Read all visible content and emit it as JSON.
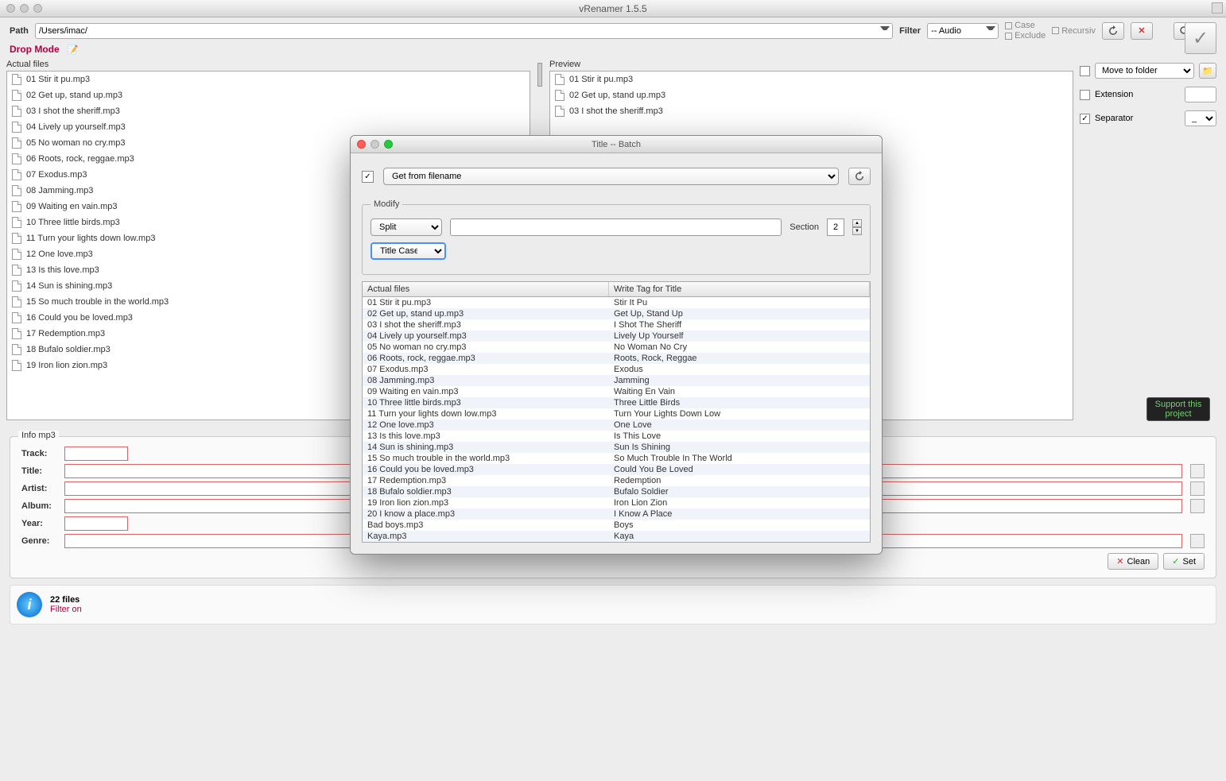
{
  "window": {
    "title": "vRenamer 1.5.5"
  },
  "toolbar": {
    "path_label": "Path",
    "path_value": "/Users/imac/",
    "filter_label": "Filter",
    "filter_value": "-- Audio",
    "case_label": "Case",
    "exclude_label": "Exclude",
    "recursiv_label": "Recursiv"
  },
  "dropmode_label": "Drop Mode",
  "actual_files_label": "Actual files",
  "preview_label": "Preview",
  "actual_files": [
    "01 Stir it pu.mp3",
    "02 Get up, stand up.mp3",
    "03 I shot the sheriff.mp3",
    "04 Lively up yourself.mp3",
    "05 No woman no cry.mp3",
    "06 Roots, rock, reggae.mp3",
    "07 Exodus.mp3",
    "08 Jamming.mp3",
    "09 Waiting en vain.mp3",
    "10 Three little birds.mp3",
    "11 Turn your lights down low.mp3",
    "12 One love.mp3",
    "13 Is this love.mp3",
    "14 Sun is shining.mp3",
    "15 So much trouble in the world.mp3",
    "16 Could you be loved.mp3",
    "17 Redemption.mp3",
    "18 Bufalo soldier.mp3",
    "19 Iron lion zion.mp3"
  ],
  "preview_files": [
    "01 Stir it pu.mp3",
    "02 Get up, stand up.mp3",
    "03 I shot the sheriff.mp3"
  ],
  "right": {
    "move_to_folder": "Move to folder",
    "extension_label": "Extension",
    "separator_label": "Separator",
    "separator_value": "_"
  },
  "support_label": "Support this project",
  "info": {
    "panel_title": "Info mp3",
    "track_label": "Track:",
    "title_label": "Title:",
    "artist_label": "Artist:",
    "album_label": "Album:",
    "year_label": "Year:",
    "genre_label": "Genre:",
    "clean_label": "Clean",
    "set_label": "Set"
  },
  "status": {
    "count": "22 files",
    "filter": "Filter on"
  },
  "modal": {
    "title": "Title -- Batch",
    "source_option": "Get from filename",
    "modify_legend": "Modify",
    "split_option": "Split",
    "titlecase_option": "Title Case",
    "section_label": "Section",
    "section_value": "2",
    "col_actual": "Actual files",
    "col_write": "Write Tag for Title",
    "rows": [
      {
        "a": "01 Stir it pu.mp3",
        "b": "Stir It Pu"
      },
      {
        "a": "02 Get up, stand up.mp3",
        "b": "Get Up, Stand Up"
      },
      {
        "a": "03 I shot the sheriff.mp3",
        "b": "I Shot The Sheriff"
      },
      {
        "a": "04 Lively up yourself.mp3",
        "b": "Lively Up Yourself"
      },
      {
        "a": "05 No woman no cry.mp3",
        "b": "No Woman No Cry"
      },
      {
        "a": "06 Roots, rock, reggae.mp3",
        "b": "Roots, Rock, Reggae"
      },
      {
        "a": "07 Exodus.mp3",
        "b": "Exodus"
      },
      {
        "a": "08 Jamming.mp3",
        "b": "Jamming"
      },
      {
        "a": "09 Waiting en vain.mp3",
        "b": "Waiting En Vain"
      },
      {
        "a": "10 Three little birds.mp3",
        "b": "Three Little Birds"
      },
      {
        "a": "11 Turn your lights down low.mp3",
        "b": "Turn Your Lights Down Low"
      },
      {
        "a": "12 One love.mp3",
        "b": "One Love"
      },
      {
        "a": "13 Is this love.mp3",
        "b": "Is This Love"
      },
      {
        "a": "14 Sun is shining.mp3",
        "b": "Sun Is Shining"
      },
      {
        "a": "15 So much trouble in the world.mp3",
        "b": "So Much Trouble In The World"
      },
      {
        "a": "16 Could you be loved.mp3",
        "b": "Could You Be Loved"
      },
      {
        "a": "17 Redemption.mp3",
        "b": "Redemption"
      },
      {
        "a": "18 Bufalo soldier.mp3",
        "b": "Bufalo Soldier"
      },
      {
        "a": "19 Iron lion zion.mp3",
        "b": "Iron Lion Zion"
      },
      {
        "a": "20 I know a place.mp3",
        "b": "I Know A Place"
      },
      {
        "a": "Bad boys.mp3",
        "b": "Boys"
      },
      {
        "a": "Kaya.mp3",
        "b": "Kaya"
      }
    ]
  }
}
